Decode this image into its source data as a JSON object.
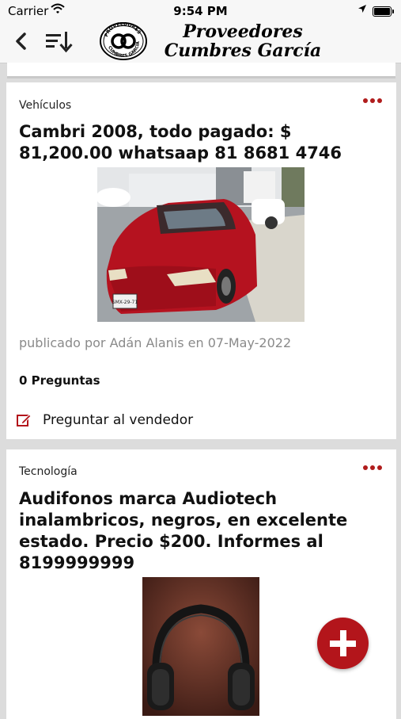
{
  "status_bar": {
    "carrier": "Carrier",
    "time": "9:54 PM"
  },
  "header": {
    "brand_line1": "Proveedores",
    "brand_line2": "Cumbres García",
    "logo_text": "PROVEEDORES CUMBRES GARCIA"
  },
  "posts": [
    {
      "category": "Vehículos",
      "title": "Cambri 2008, todo pagado: $ 81,200.00 whatsaap  81 8681 4746",
      "author_line": "publicado por Adán Alanis  en 07-May-2022",
      "questions": "0 Preguntas",
      "ask_label": "Preguntar al vendedor",
      "plate": "SMX-29-71"
    },
    {
      "category": "Tecnología",
      "title": "Audifonos marca Audiotech inalambricos, negros, en excelente estado. Precio $200. Informes al 8199999999"
    }
  ],
  "colors": {
    "accent": "#b3151b",
    "background": "#dcdcdc"
  },
  "icons": {
    "back": "chevron-left-icon",
    "sort": "sort-icon",
    "more": "more-dots-icon",
    "edit": "edit-icon",
    "add": "plus-icon"
  }
}
